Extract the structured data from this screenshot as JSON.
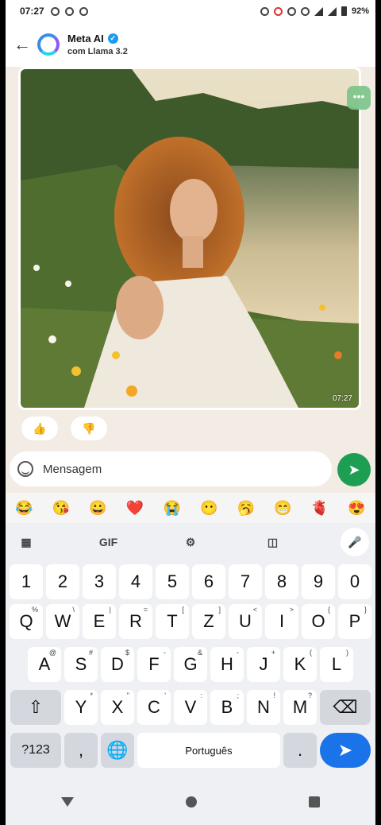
{
  "status_bar": {
    "time": "07:27",
    "battery": "92%"
  },
  "header": {
    "back_icon": "arrow-left-icon",
    "title": "Meta AI",
    "verified_icon": "verified-badge-icon",
    "subtitle": "com Llama 3.2"
  },
  "message": {
    "timestamp": "07:27",
    "more_label": "•••"
  },
  "reactions": {
    "thumbs_up": "👍",
    "thumbs_down": "👎"
  },
  "input": {
    "placeholder": "Mensagem"
  },
  "emoji_bar": [
    "😂",
    "😘",
    "😀",
    "❤️",
    "😭",
    "😶",
    "🥱",
    "😁",
    "🫀",
    "😍"
  ],
  "keyboard": {
    "toolbar": {
      "gif": "GIF"
    },
    "row1": [
      "1",
      "2",
      "3",
      "4",
      "5",
      "6",
      "7",
      "8",
      "9",
      "0"
    ],
    "row2": [
      "Q",
      "W",
      "E",
      "R",
      "T",
      "Z",
      "U",
      "I",
      "O",
      "P"
    ],
    "row2_hints": [
      "%",
      "\\",
      "|",
      "=",
      "[",
      "]",
      "<",
      ">",
      "{",
      "}"
    ],
    "row3": [
      "A",
      "S",
      "D",
      "F",
      "G",
      "H",
      "J",
      "K",
      "L"
    ],
    "row3_hints": [
      "@",
      "#",
      "$",
      "-",
      "&",
      "-",
      "+",
      "(",
      ")"
    ],
    "row4": [
      "Y",
      "X",
      "C",
      "V",
      "B",
      "N",
      "M"
    ],
    "row4_hints": [
      "*",
      "\"",
      "'",
      ":",
      ";",
      "!",
      "?"
    ],
    "num_key": "?123",
    "comma_key": ",",
    "space_label": "Português",
    "period_key": "."
  },
  "colors": {
    "send_green": "#1e9e52",
    "enter_blue": "#1a73e8",
    "chat_bg": "#f2ece4"
  }
}
